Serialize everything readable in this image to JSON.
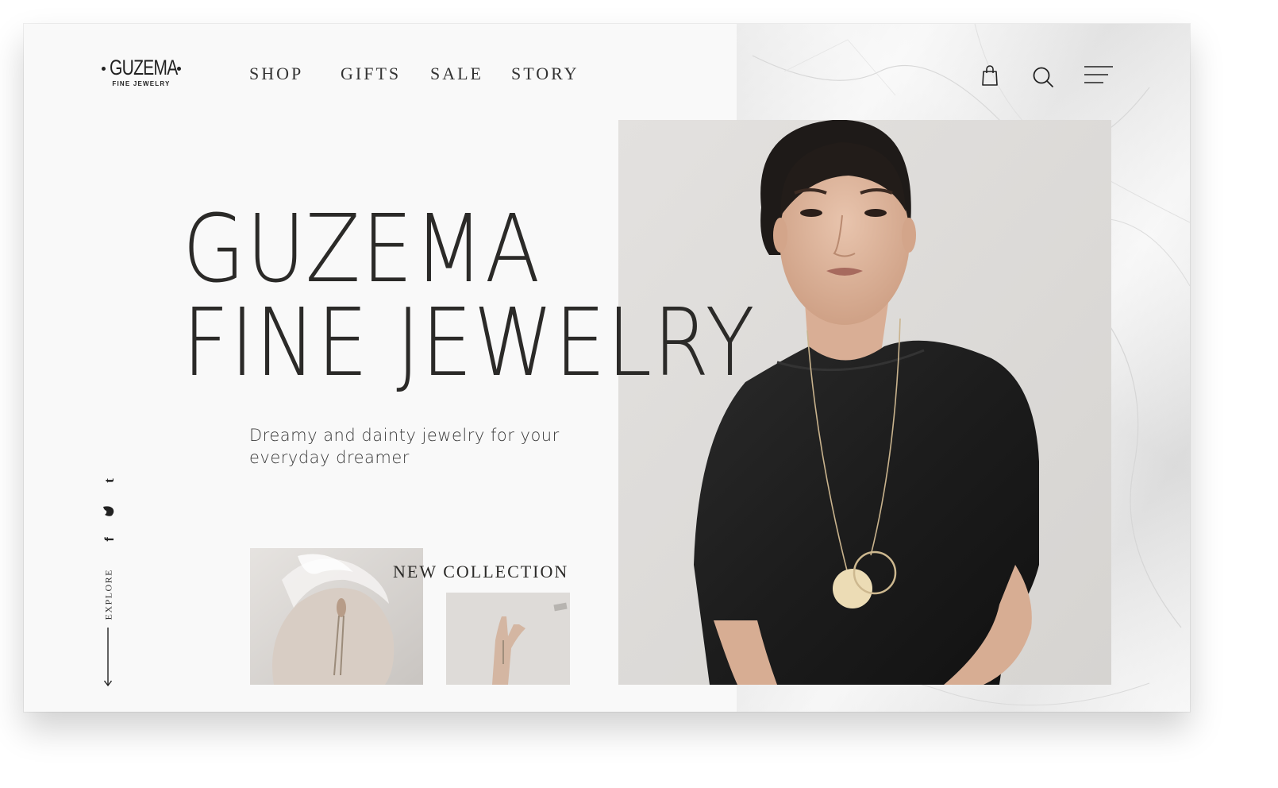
{
  "brand": {
    "logo_text": "GUZEMA",
    "logo_subtext": "FINE JEWELRY"
  },
  "nav": {
    "items": [
      {
        "label": "SHOP"
      },
      {
        "label": "GIFTS"
      },
      {
        "label": "SALE"
      },
      {
        "label": "STORY"
      }
    ]
  },
  "header_icons": [
    "shopping-bag-icon",
    "search-icon",
    "menu-icon"
  ],
  "hero": {
    "title_line1": "GUZEMA",
    "title_line2": "FINE JEWELRY",
    "subtitle": "Dreamy and dainty jewelry for your everyday dreamer"
  },
  "social": [
    "tumblr-icon",
    "twitter-icon",
    "facebook-icon"
  ],
  "explore": {
    "label": "EXPLORE"
  },
  "collection": {
    "label": "NEW COLLECTION"
  },
  "colors": {
    "background": "#f9f9f9",
    "text": "#2b2a28",
    "marble": "#ececec"
  }
}
